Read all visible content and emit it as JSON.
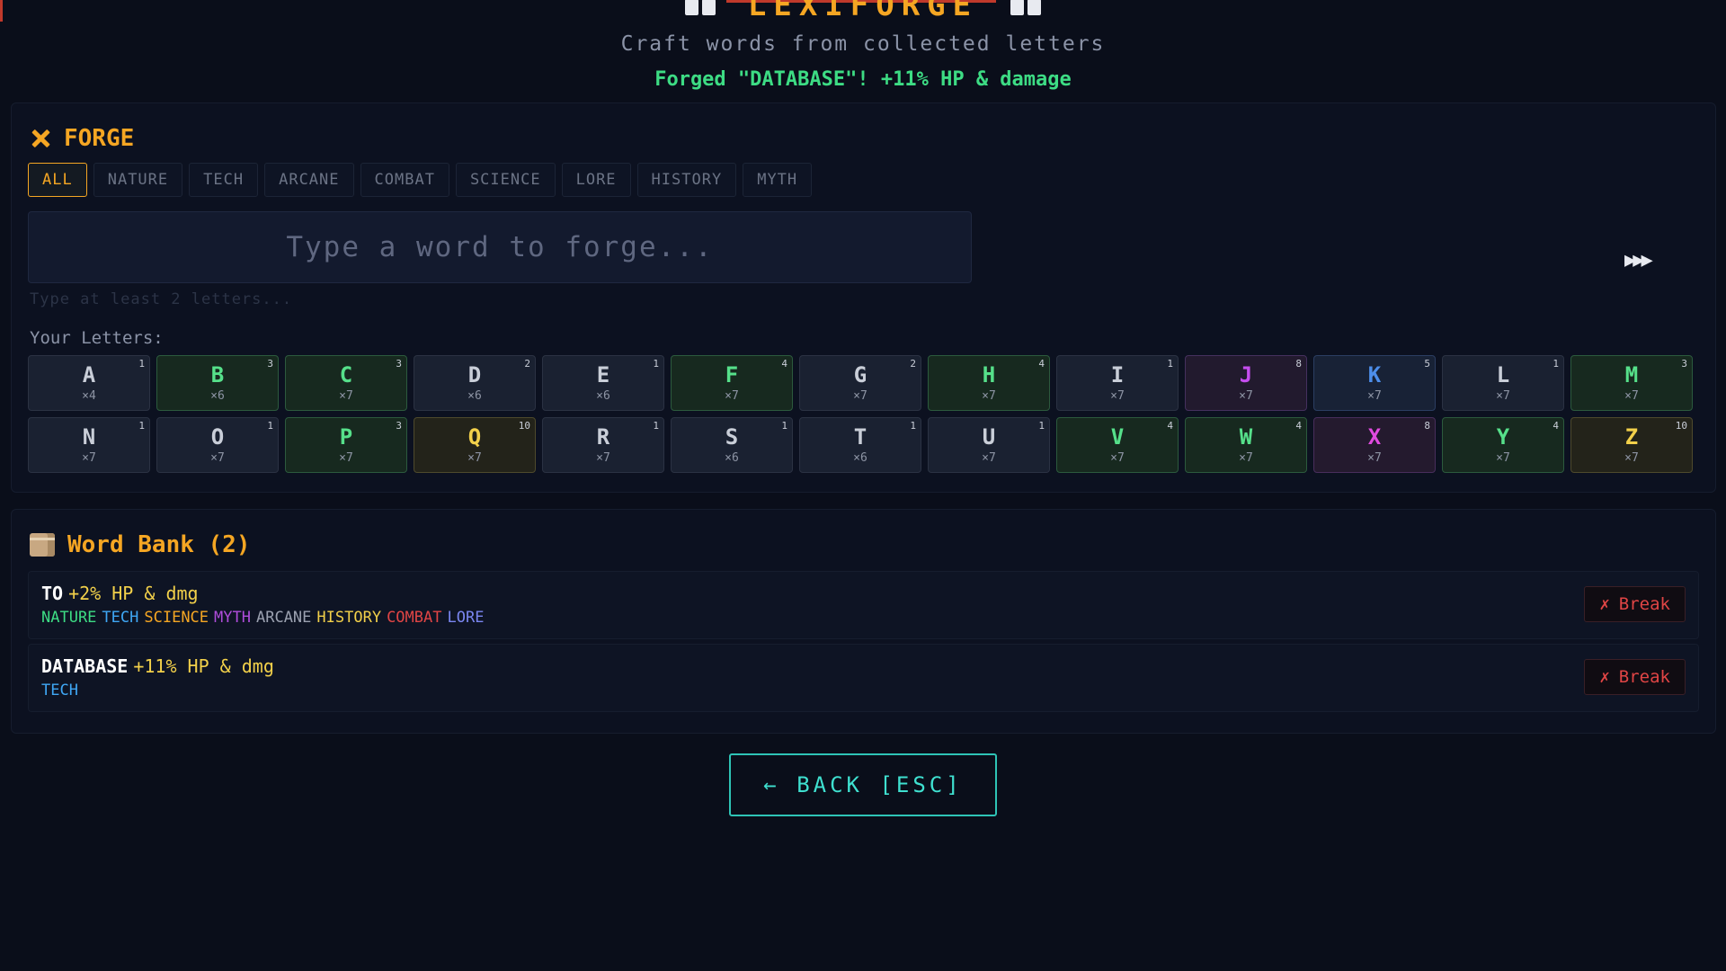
{
  "header": {
    "title": "LEXIFORGE",
    "subtitle": "Craft words from collected letters",
    "flash_message": "Forged \"DATABASE\"! +11% HP & damage",
    "icon": "book-icon"
  },
  "forge": {
    "title": "FORGE",
    "icon": "hammer-icon",
    "tabs": [
      "ALL",
      "NATURE",
      "TECH",
      "ARCANE",
      "COMBAT",
      "SCIENCE",
      "LORE",
      "HISTORY",
      "MYTH"
    ],
    "active_tab": "ALL",
    "input_value": "",
    "input_placeholder": "Type a word to forge...",
    "hint": "Type at least 2 letters...",
    "letters_label": "Your Letters:",
    "cursor_glyph": "▶▶▶",
    "letters": [
      {
        "ch": "A",
        "count": "×4",
        "pts": "1",
        "style": "plain"
      },
      {
        "ch": "B",
        "count": "×6",
        "pts": "3",
        "style": "green"
      },
      {
        "ch": "C",
        "count": "×7",
        "pts": "3",
        "style": "green"
      },
      {
        "ch": "D",
        "count": "×6",
        "pts": "2",
        "style": "plain"
      },
      {
        "ch": "E",
        "count": "×6",
        "pts": "1",
        "style": "plain"
      },
      {
        "ch": "F",
        "count": "×7",
        "pts": "4",
        "style": "green"
      },
      {
        "ch": "G",
        "count": "×7",
        "pts": "2",
        "style": "plain"
      },
      {
        "ch": "H",
        "count": "×7",
        "pts": "4",
        "style": "green"
      },
      {
        "ch": "I",
        "count": "×7",
        "pts": "1",
        "style": "plain"
      },
      {
        "ch": "J",
        "count": "×7",
        "pts": "8",
        "style": "purple"
      },
      {
        "ch": "K",
        "count": "×7",
        "pts": "5",
        "style": "blue"
      },
      {
        "ch": "L",
        "count": "×7",
        "pts": "1",
        "style": "plain"
      },
      {
        "ch": "M",
        "count": "×7",
        "pts": "3",
        "style": "green"
      },
      {
        "ch": "N",
        "count": "×7",
        "pts": "1",
        "style": "plain"
      },
      {
        "ch": "O",
        "count": "×7",
        "pts": "1",
        "style": "plain"
      },
      {
        "ch": "P",
        "count": "×7",
        "pts": "3",
        "style": "green"
      },
      {
        "ch": "Q",
        "count": "×7",
        "pts": "10",
        "style": "gold"
      },
      {
        "ch": "R",
        "count": "×7",
        "pts": "1",
        "style": "plain"
      },
      {
        "ch": "S",
        "count": "×6",
        "pts": "1",
        "style": "plain"
      },
      {
        "ch": "T",
        "count": "×6",
        "pts": "1",
        "style": "plain"
      },
      {
        "ch": "U",
        "count": "×7",
        "pts": "1",
        "style": "plain"
      },
      {
        "ch": "V",
        "count": "×7",
        "pts": "4",
        "style": "green"
      },
      {
        "ch": "W",
        "count": "×7",
        "pts": "4",
        "style": "green"
      },
      {
        "ch": "X",
        "count": "×7",
        "pts": "8",
        "style": "magenta"
      },
      {
        "ch": "Y",
        "count": "×7",
        "pts": "4",
        "style": "green"
      },
      {
        "ch": "Z",
        "count": "×7",
        "pts": "10",
        "style": "gold"
      }
    ]
  },
  "word_bank": {
    "title": "Word Bank (2)",
    "icon": "box-icon",
    "words": [
      {
        "word": "TO",
        "bonus": "+2% HP & dmg",
        "categories": [
          "NATURE",
          "TECH",
          "SCIENCE",
          "MYTH",
          "ARCANE",
          "HISTORY",
          "COMBAT",
          "LORE"
        ],
        "break_label": "Break",
        "break_icon": "✗"
      },
      {
        "word": "DATABASE",
        "bonus": "+11% HP & dmg",
        "categories": [
          "TECH"
        ],
        "break_label": "Break",
        "break_icon": "✗"
      }
    ]
  },
  "back_button": {
    "label": "← BACK [ESC]"
  },
  "colors": {
    "accent": "#f5a623",
    "success": "#3ddc84",
    "danger": "#e04545",
    "teal": "#2ec4b6",
    "background": "#0a0e1a"
  }
}
